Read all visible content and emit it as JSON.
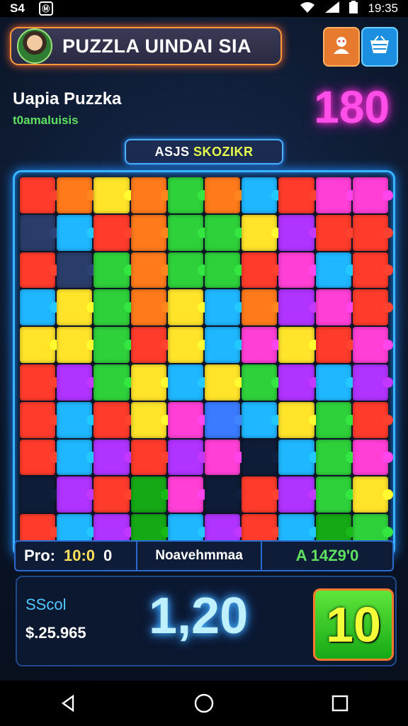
{
  "status_bar": {
    "left_text": "S4",
    "notif_glyph": "Ⓜ",
    "time": "19:35",
    "icons": [
      "wifi-icon",
      "signal-icon",
      "battery-icon"
    ]
  },
  "header": {
    "title": "PUZZLA UINDAI SIA",
    "profile_icon": "profile-icon",
    "shop_icon": "cart-icon"
  },
  "player": {
    "name": "Uapia Puzzka",
    "subtitle": "t0amaluisis",
    "score": "180"
  },
  "mode_chip": {
    "part1": "ASJS",
    "part2": "SKOZIKR"
  },
  "board": {
    "columns": 10,
    "rows": 10,
    "palette": [
      "#ff3b2b",
      "#ff7a1a",
      "#ffe42a",
      "#2fd13a",
      "#1fb7ff",
      "#3a7bff",
      "#b033ff",
      "#ff3fd6",
      "#16a916",
      "#6b2dff",
      "#2a3d6a",
      "#0f1c38"
    ],
    "pieces": [
      0,
      1,
      2,
      1,
      3,
      1,
      4,
      0,
      7,
      7,
      10,
      4,
      0,
      1,
      3,
      3,
      2,
      6,
      0,
      0,
      0,
      10,
      3,
      1,
      3,
      3,
      0,
      7,
      4,
      0,
      4,
      2,
      3,
      1,
      2,
      4,
      1,
      6,
      7,
      0,
      2,
      2,
      3,
      0,
      2,
      4,
      7,
      2,
      0,
      7,
      0,
      6,
      3,
      2,
      4,
      2,
      3,
      6,
      4,
      6,
      0,
      4,
      0,
      2,
      7,
      5,
      4,
      2,
      3,
      0,
      0,
      4,
      6,
      0,
      6,
      7,
      11,
      4,
      3,
      7,
      11,
      6,
      0,
      8,
      7,
      11,
      0,
      6,
      3,
      2,
      0,
      4,
      6,
      8,
      4,
      6,
      0,
      4,
      8,
      3
    ]
  },
  "info_row": {
    "label": "Pro:",
    "time": "10:0",
    "count": "0",
    "middle": "Noavehmmaa",
    "right": "A 14Z9'0"
  },
  "bottom": {
    "score_label": "SScol",
    "amount": "$.25.965",
    "big_value": "1,20",
    "level": "10"
  },
  "nav": {
    "back": "◁",
    "home": "○",
    "recent": "□"
  }
}
